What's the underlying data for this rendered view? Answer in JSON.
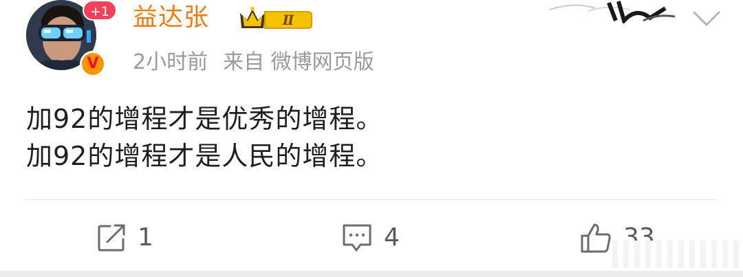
{
  "post": {
    "user": {
      "name": "益达张",
      "notification_badge": "+1",
      "verified_mark": "V",
      "vip_level": "Ⅱ"
    },
    "meta": {
      "time": "2小时前",
      "source": "来自 微博网页版"
    },
    "content": [
      "加92的增程才是优秀的增程。",
      "加92的增程才是人民的增程。"
    ],
    "actions": {
      "repost_count": "1",
      "comment_count": "4",
      "like_count": "33"
    },
    "icons": {
      "repost": "repost-icon",
      "comment": "comment-icon",
      "like": "thumbs-up-icon",
      "dropdown": "chevron-down-icon",
      "vip": "crown-icon"
    },
    "colors": {
      "username": "#f07a14",
      "meta_text": "#9a9a9a",
      "body_text": "#1e1e1e",
      "badge_red": "#f2415a",
      "verified_orange": "#ff9500",
      "vip_gold": "#f5c200"
    }
  }
}
